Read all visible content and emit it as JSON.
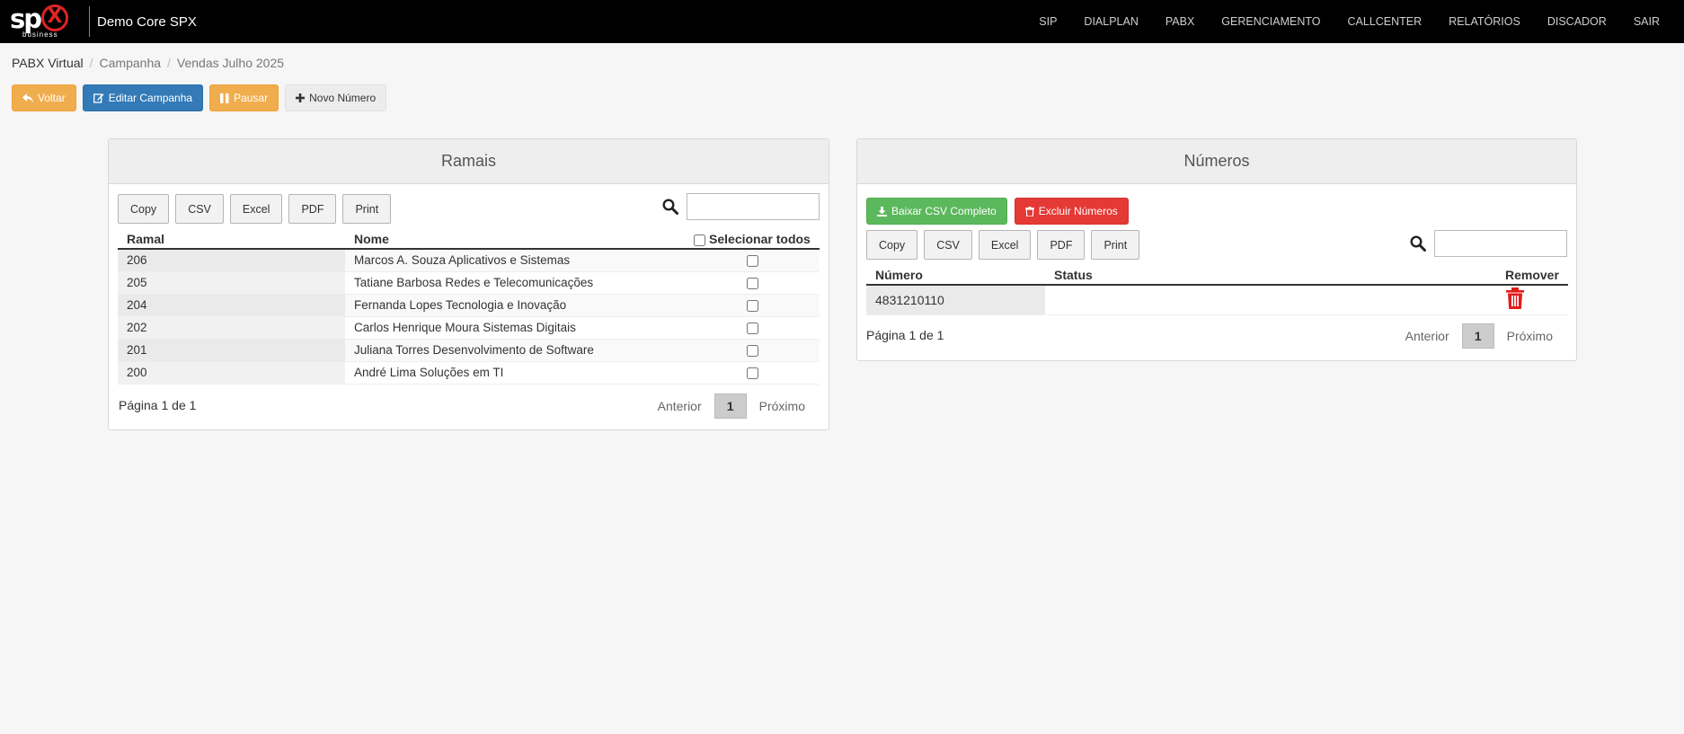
{
  "navbar": {
    "logo_text": "sp",
    "logo_mark": "X",
    "logo_sub": "business",
    "brand": "Demo Core SPX",
    "menu": [
      {
        "label": "SIP"
      },
      {
        "label": "DIALPLAN"
      },
      {
        "label": "PABX"
      },
      {
        "label": "GERENCIAMENTO"
      },
      {
        "label": "CALLCENTER"
      },
      {
        "label": "RELATÓRIOS"
      },
      {
        "label": "DISCADOR"
      },
      {
        "label": "SAIR"
      }
    ]
  },
  "breadcrumb": {
    "items": [
      "PABX Virtual",
      "Campanha",
      "Vendas Julho 2025"
    ]
  },
  "toolbar": {
    "voltar": "Voltar",
    "editar": "Editar Campanha",
    "pausar": "Pausar",
    "novo_numero": "Novo Número"
  },
  "ramais": {
    "title": "Ramais",
    "export": [
      "Copy",
      "CSV",
      "Excel",
      "PDF",
      "Print"
    ],
    "columns": {
      "ramal": "Ramal",
      "nome": "Nome",
      "select_all": "Selecionar todos"
    },
    "rows": [
      {
        "ramal": "206",
        "nome": "Marcos A. Souza Aplicativos e Sistemas"
      },
      {
        "ramal": "205",
        "nome": "Tatiane Barbosa Redes e Telecomunicações"
      },
      {
        "ramal": "204",
        "nome": "Fernanda Lopes Tecnologia e Inovação"
      },
      {
        "ramal": "202",
        "nome": "Carlos Henrique Moura Sistemas Digitais"
      },
      {
        "ramal": "201",
        "nome": "Juliana Torres Desenvolvimento de Software"
      },
      {
        "ramal": "200",
        "nome": "André Lima Soluções em TI"
      }
    ],
    "page_info": "Página 1 de 1",
    "pager": {
      "prev": "Anterior",
      "current": "1",
      "next": "Próximo"
    }
  },
  "numeros": {
    "title": "Números",
    "baixar_csv": "Baixar CSV Completo",
    "excluir": "Excluir Números",
    "export": [
      "Copy",
      "CSV",
      "Excel",
      "PDF",
      "Print"
    ],
    "columns": {
      "numero": "Número",
      "status": "Status",
      "remover": "Remover"
    },
    "rows": [
      {
        "numero": "4831210110",
        "status": ""
      }
    ],
    "page_info": "Página 1 de 1",
    "pager": {
      "prev": "Anterior",
      "current": "1",
      "next": "Próximo"
    }
  },
  "colors": {
    "navbar": "#000000",
    "warning": "#f0ad4e",
    "primary": "#337ab7",
    "success": "#5cb85c",
    "danger": "#e53935"
  }
}
